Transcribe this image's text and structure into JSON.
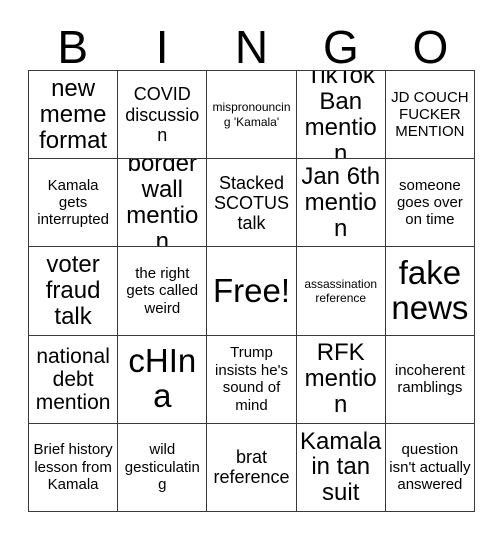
{
  "card": {
    "header_letters": [
      "B",
      "I",
      "N",
      "G",
      "O"
    ],
    "rows": [
      [
        {
          "text": "new meme format",
          "size": "xl"
        },
        {
          "text": "COVID discussion",
          "size": "md"
        },
        {
          "text": "mispronouncing 'Kamala'",
          "size": "xs"
        },
        {
          "text": "TikTok Ban mention",
          "size": "xl"
        },
        {
          "text": "JD COUCH FUCKER MENTION",
          "size": "sm"
        }
      ],
      [
        {
          "text": "Kamala gets interrupted",
          "size": "sm"
        },
        {
          "text": "border wall mention",
          "size": "xl"
        },
        {
          "text": "Stacked SCOTUS talk",
          "size": "md"
        },
        {
          "text": "Jan 6th mention",
          "size": "xl"
        },
        {
          "text": "someone goes over on time",
          "size": "sm"
        }
      ],
      [
        {
          "text": "voter fraud talk",
          "size": "xl"
        },
        {
          "text": "the right gets called weird",
          "size": "sm"
        },
        {
          "text": "Free!",
          "size": "xxl"
        },
        {
          "text": "assassination reference",
          "size": "xs"
        },
        {
          "text": "fake news",
          "size": "xxl"
        }
      ],
      [
        {
          "text": "national debt mention",
          "size": "lg"
        },
        {
          "text": "cHIna",
          "size": "xxl"
        },
        {
          "text": "Trump insists he's sound of mind",
          "size": "sm"
        },
        {
          "text": "RFK mention",
          "size": "xl"
        },
        {
          "text": "incoherent ramblings",
          "size": "sm"
        }
      ],
      [
        {
          "text": "Brief history lesson from Kamala",
          "size": "sm"
        },
        {
          "text": "wild gesticulating",
          "size": "sm"
        },
        {
          "text": "brat reference",
          "size": "md"
        },
        {
          "text": "Kamala in tan suit",
          "size": "xl"
        },
        {
          "text": "question isn't actually answered",
          "size": "sm"
        }
      ]
    ]
  },
  "colors": {
    "background": "#ffffff",
    "grid_line": "#3a3a3a",
    "text": "#000000"
  }
}
